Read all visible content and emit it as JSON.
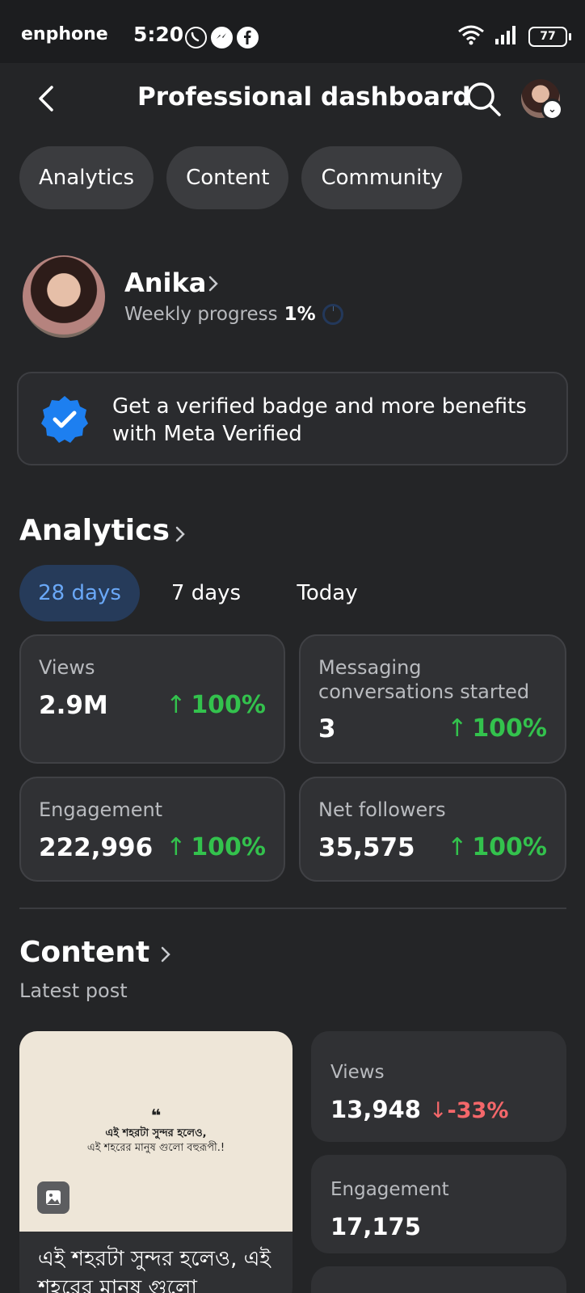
{
  "status_bar": {
    "carrier": "enphone",
    "time": "5:20",
    "battery": "77",
    "app_icons": [
      "whatsapp-icon",
      "messenger-icon",
      "facebook-icon"
    ]
  },
  "header": {
    "title": "Professional dashboard"
  },
  "chips": [
    "Analytics",
    "Content",
    "Community"
  ],
  "profile": {
    "name": "Anika",
    "weekly_label": "Weekly progress",
    "weekly_value": "1%",
    "weekly_progress": 0.01
  },
  "verified_banner": {
    "text": "Get a verified badge and more benefits with Meta Verified"
  },
  "analytics": {
    "title": "Analytics",
    "ranges": [
      "28 days",
      "7 days",
      "Today"
    ],
    "active_range": "28 days",
    "stats": [
      {
        "label": "Views",
        "value": "2.9M",
        "change": "100%"
      },
      {
        "label": "Messaging conversations started",
        "value": "3",
        "change": "100%"
      },
      {
        "label": "Engagement",
        "value": "222,996",
        "change": "100%"
      },
      {
        "label": "Net followers",
        "value": "35,575",
        "change": "100%"
      }
    ]
  },
  "content": {
    "title": "Content",
    "latest_post_label": "Latest post",
    "post_image_quote": "❝",
    "post_image_line1": "এই শহরটা সুন্দর হলেও,",
    "post_image_line2": "এই শহরের মানুষ গুলো বহুরূপী.!",
    "post_caption": "এই শহরটা সুন্দর হলেও, এই শহরের মানুষ গুলো",
    "views_label": "Views",
    "views_value": "13,948",
    "views_change": "-33%",
    "engagement_label": "Engagement",
    "engagement_value": "17,175"
  },
  "colors": {
    "background": "#242527",
    "card": "#303134",
    "positive": "#33c24d",
    "negative": "#f4676a",
    "accent": "#6aa8f7",
    "verified": "#1d7ff0"
  }
}
